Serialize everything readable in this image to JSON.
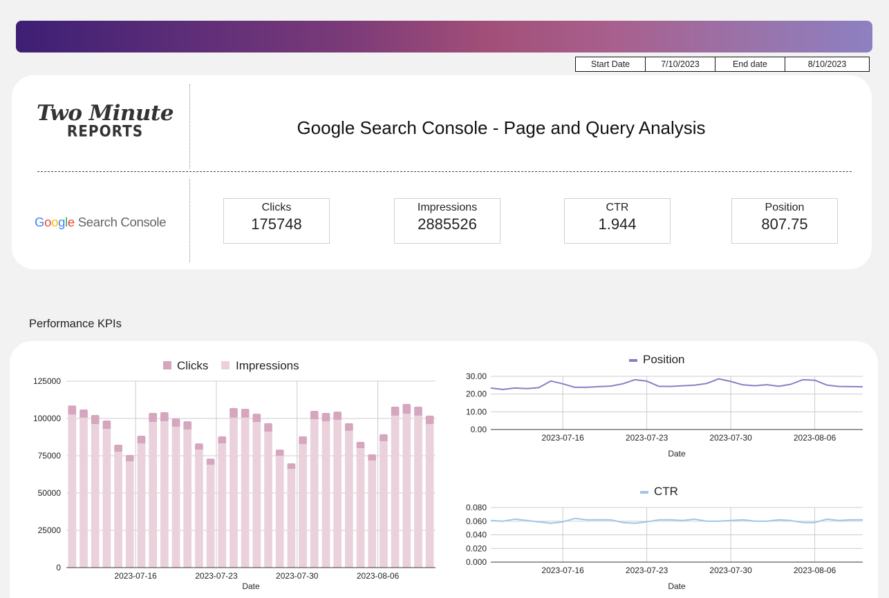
{
  "header": {
    "banner_colors": [
      "#3d1f74",
      "#a24f78",
      "#8d80c2"
    ]
  },
  "date_range": {
    "start_label": "Start Date",
    "start_value": "7/10/2023",
    "end_label": "End date",
    "end_value": "8/10/2023"
  },
  "branding": {
    "logo_script": "Two Minute",
    "logo_sub": "REPORTS",
    "gsc_google_letters": [
      "G",
      "o",
      "o",
      "g",
      "l",
      "e"
    ],
    "gsc_suffix": "Search Console"
  },
  "title": "Google Search Console - Page and Query Analysis",
  "kpis": [
    {
      "label": "Clicks",
      "value": "175748"
    },
    {
      "label": "Impressions",
      "value": "2885526"
    },
    {
      "label": "CTR",
      "value": "1.944"
    },
    {
      "label": "Position",
      "value": "807.75"
    }
  ],
  "section_title": "Performance KPIs",
  "chart_data": [
    {
      "type": "bar",
      "stacked": true,
      "title": "",
      "legend": [
        "Clicks",
        "Impressions"
      ],
      "legend_position": "top",
      "colors": {
        "Clicks": "#d5a6bd",
        "Impressions": "#ead1dc"
      },
      "xlabel": "Date",
      "ylabel": "",
      "ylim": [
        0,
        125000
      ],
      "yticks": [
        0,
        25000,
        50000,
        75000,
        100000,
        125000
      ],
      "xtick_labels": [
        "2023-07-16",
        "2023-07-23",
        "2023-07-30",
        "2023-08-06"
      ],
      "grid": true,
      "categories": [
        "2023-07-10",
        "2023-07-11",
        "2023-07-12",
        "2023-07-13",
        "2023-07-14",
        "2023-07-15",
        "2023-07-16",
        "2023-07-17",
        "2023-07-18",
        "2023-07-19",
        "2023-07-20",
        "2023-07-21",
        "2023-07-22",
        "2023-07-23",
        "2023-07-24",
        "2023-07-25",
        "2023-07-26",
        "2023-07-27",
        "2023-07-28",
        "2023-07-29",
        "2023-07-30",
        "2023-07-31",
        "2023-08-01",
        "2023-08-02",
        "2023-08-03",
        "2023-08-04",
        "2023-08-05",
        "2023-08-06",
        "2023-08-07",
        "2023-08-08",
        "2023-08-09",
        "2023-08-10"
      ],
      "series": [
        {
          "name": "Impressions",
          "values": [
            102600,
            100500,
            96300,
            93000,
            77800,
            71300,
            83300,
            97700,
            98100,
            94400,
            92600,
            79100,
            69000,
            83300,
            100500,
            100500,
            97700,
            91200,
            75000,
            66200,
            82900,
            99500,
            98100,
            99100,
            91700,
            80100,
            71800,
            84700,
            101900,
            103200,
            101900,
            96300
          ]
        },
        {
          "name": "Clicks",
          "values": [
            6100,
            5500,
            6000,
            5600,
            4600,
            4200,
            5100,
            6000,
            6100,
            5600,
            5500,
            4200,
            4100,
            4700,
            6500,
            6000,
            5500,
            5600,
            4100,
            3700,
            5100,
            5600,
            5600,
            5500,
            5100,
            4200,
            4100,
            4700,
            6000,
            6500,
            6000,
            5600
          ]
        }
      ]
    },
    {
      "type": "line",
      "title": "",
      "legend": [
        "Position"
      ],
      "legend_position": "top",
      "color": "#8e7cc3",
      "xlabel": "Date",
      "ylim": [
        0,
        30
      ],
      "yticks": [
        "0.00",
        "10.00",
        "20.00",
        "30.00"
      ],
      "xtick_labels": [
        "2023-07-16",
        "2023-07-23",
        "2023-07-30",
        "2023-08-06"
      ],
      "grid": true,
      "x": [
        "2023-07-10",
        "2023-07-11",
        "2023-07-12",
        "2023-07-13",
        "2023-07-14",
        "2023-07-15",
        "2023-07-16",
        "2023-07-17",
        "2023-07-18",
        "2023-07-19",
        "2023-07-20",
        "2023-07-21",
        "2023-07-22",
        "2023-07-23",
        "2023-07-24",
        "2023-07-25",
        "2023-07-26",
        "2023-07-27",
        "2023-07-28",
        "2023-07-29",
        "2023-07-30",
        "2023-07-31",
        "2023-08-01",
        "2023-08-02",
        "2023-08-03",
        "2023-08-04",
        "2023-08-05",
        "2023-08-06",
        "2023-08-07",
        "2023-08-08",
        "2023-08-09",
        "2023-08-10"
      ],
      "series": [
        {
          "name": "Position",
          "values": [
            23.4,
            22.6,
            23.4,
            23.1,
            23.6,
            27.4,
            25.8,
            23.8,
            23.8,
            24.2,
            24.5,
            25.8,
            28.1,
            27.3,
            24.4,
            24.3,
            24.7,
            25.0,
            26.0,
            28.6,
            27.1,
            25.2,
            24.7,
            25.3,
            24.4,
            25.5,
            28.1,
            27.8,
            25.1,
            24.3,
            24.2,
            24.1
          ]
        }
      ]
    },
    {
      "type": "line",
      "title": "",
      "legend": [
        "CTR"
      ],
      "legend_position": "top",
      "color": "#9fc5e8",
      "xlabel": "Date",
      "ylim": [
        0,
        0.08
      ],
      "yticks": [
        "0.000",
        "0.020",
        "0.040",
        "0.060",
        "0.080"
      ],
      "xtick_labels": [
        "2023-07-16",
        "2023-07-23",
        "2023-07-30",
        "2023-08-06"
      ],
      "grid": true,
      "x": [
        "2023-07-10",
        "2023-07-11",
        "2023-07-12",
        "2023-07-13",
        "2023-07-14",
        "2023-07-15",
        "2023-07-16",
        "2023-07-17",
        "2023-07-18",
        "2023-07-19",
        "2023-07-20",
        "2023-07-21",
        "2023-07-22",
        "2023-07-23",
        "2023-07-24",
        "2023-07-25",
        "2023-07-26",
        "2023-07-27",
        "2023-07-28",
        "2023-07-29",
        "2023-07-30",
        "2023-07-31",
        "2023-08-01",
        "2023-08-02",
        "2023-08-03",
        "2023-08-04",
        "2023-08-05",
        "2023-08-06",
        "2023-08-07",
        "2023-08-08",
        "2023-08-09",
        "2023-08-10"
      ],
      "series": [
        {
          "name": "CTR",
          "values": [
            0.061,
            0.06,
            0.063,
            0.061,
            0.059,
            0.057,
            0.059,
            0.064,
            0.062,
            0.062,
            0.062,
            0.058,
            0.057,
            0.059,
            0.062,
            0.062,
            0.061,
            0.063,
            0.06,
            0.06,
            0.061,
            0.062,
            0.06,
            0.06,
            0.062,
            0.061,
            0.058,
            0.058,
            0.063,
            0.061,
            0.062,
            0.062
          ]
        }
      ]
    }
  ]
}
